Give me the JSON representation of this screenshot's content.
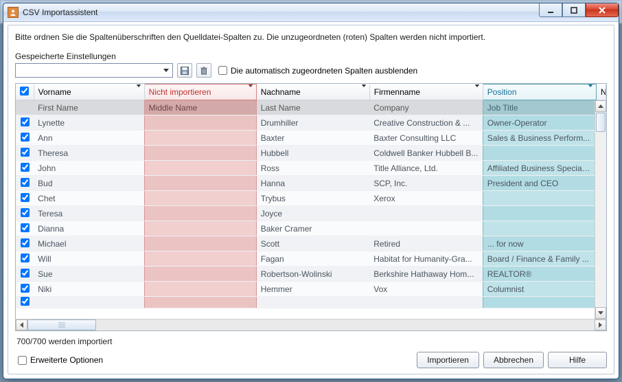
{
  "window": {
    "title": "CSV Importassistent"
  },
  "instruction": "Bitte ordnen Sie die Spaltenüberschriften den Quelldatei-Spalten zu. Die unzugeordneten (roten) Spalten werden nicht importiert.",
  "settings": {
    "saved_label": "Gespeicherte Einstellungen",
    "hide_auto_label": "Die automatisch zugeordneten Spalten ausblenden",
    "hide_auto_checked": false
  },
  "columns": [
    {
      "label": "Vorname",
      "state": "normal"
    },
    {
      "label": "Nicht importieren",
      "state": "red"
    },
    {
      "label": "Nachname",
      "state": "normal"
    },
    {
      "label": "Firmenname",
      "state": "normal"
    },
    {
      "label": "Position",
      "state": "blue"
    }
  ],
  "extra_header_letter": "N",
  "source_header_row": [
    "First Name",
    "Middle Name",
    "Last Name",
    "Company",
    "Job Title"
  ],
  "rows": [
    {
      "checked": true,
      "cells": [
        "Lynette",
        "",
        "Drumhiller",
        "Creative Construction & ...",
        "Owner-Operator"
      ]
    },
    {
      "checked": true,
      "cells": [
        "Ann",
        "",
        "Baxter",
        "Baxter Consulting LLC",
        "Sales & Business Perform..."
      ]
    },
    {
      "checked": true,
      "cells": [
        "Theresa",
        "",
        "Hubbell",
        "Coldwell Banker Hubbell B...",
        ""
      ]
    },
    {
      "checked": true,
      "cells": [
        "John",
        "",
        "Ross",
        "Title Alliance, Ltd.",
        "Affiliated Business Specialist"
      ]
    },
    {
      "checked": true,
      "cells": [
        "Bud",
        "",
        "Hanna",
        "SCP, Inc.",
        "President and CEO"
      ]
    },
    {
      "checked": true,
      "cells": [
        "Chet",
        "",
        "Trybus",
        "Xerox",
        ""
      ]
    },
    {
      "checked": true,
      "cells": [
        "Teresa",
        "",
        "Joyce",
        "",
        ""
      ]
    },
    {
      "checked": true,
      "cells": [
        "Dianna",
        "",
        "Baker Cramer",
        "",
        ""
      ]
    },
    {
      "checked": true,
      "cells": [
        "Michael",
        "",
        "Scott",
        "Retired",
        "... for now"
      ]
    },
    {
      "checked": true,
      "cells": [
        "Will",
        "",
        "Fagan",
        "Habitat for Humanity-Gra...",
        "Board / Finance & Family ..."
      ]
    },
    {
      "checked": true,
      "cells": [
        "Sue",
        "",
        "Robertson-Wolinski",
        "Berkshire Hathaway Hom...",
        "REALTOR®"
      ]
    },
    {
      "checked": true,
      "cells": [
        "Niki",
        "",
        "Hemmer",
        "Vox",
        "Columnist"
      ]
    }
  ],
  "status": "700/700 werden importiert",
  "footer": {
    "advanced_label": "Erweiterte Optionen",
    "advanced_checked": false,
    "import_label": "Importieren",
    "cancel_label": "Abbrechen",
    "help_label": "Hilfe"
  }
}
